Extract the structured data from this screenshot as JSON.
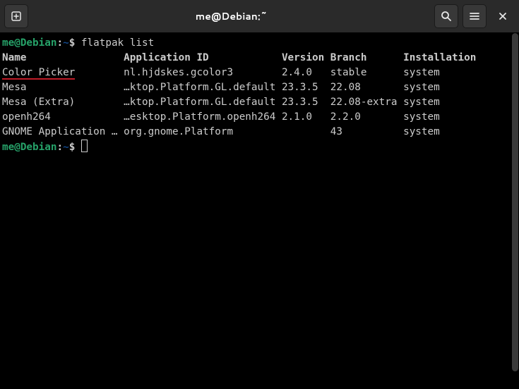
{
  "window": {
    "title": "me@Debian:~"
  },
  "prompt": {
    "userhost": "me@Debian",
    "colon": ":",
    "path": "~",
    "dollar": "$ "
  },
  "command": "flatpak list",
  "headers": {
    "name": "Name",
    "appid": "Application ID",
    "version": "Version",
    "branch": "Branch",
    "installation": "Installation"
  },
  "rows": [
    {
      "name": "Color Picker",
      "name_red": "Color Picker",
      "appid": "nl.hjdskes.gcolor3",
      "version": "2.4.0",
      "branch": "stable",
      "installation": "system"
    },
    {
      "name": "Mesa",
      "appid": "…ktop.Platform.GL.default",
      "version": "23.3.5",
      "branch": "22.08",
      "installation": "system"
    },
    {
      "name": "Mesa (Extra)",
      "appid": "…ktop.Platform.GL.default",
      "version": "23.3.5",
      "branch": "22.08-extra",
      "installation": "system"
    },
    {
      "name": "openh264",
      "appid": "…esktop.Platform.openh264",
      "version": "2.1.0",
      "branch": "2.2.0",
      "installation": "system"
    },
    {
      "name": "GNOME Application …",
      "appid": "org.gnome.Platform",
      "version": "",
      "branch": "43",
      "installation": "system"
    }
  ],
  "cols": {
    "name": 20,
    "appid": 26,
    "version": 8,
    "branch": 12
  }
}
